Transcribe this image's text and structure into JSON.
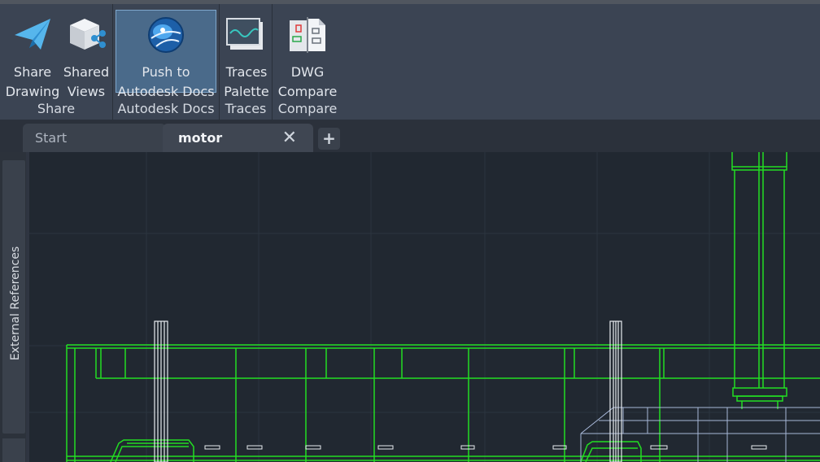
{
  "ribbon": {
    "panels": [
      {
        "title": "Share",
        "buttons": [
          {
            "line1": "Share",
            "line2": "Drawing",
            "icon": "paper-plane-icon"
          },
          {
            "line1": "Shared",
            "line2": "Views",
            "icon": "shared-views-cube-icon"
          }
        ]
      },
      {
        "title": "Autodesk Docs",
        "buttons": [
          {
            "line1": "Push to",
            "line2": "Autodesk Docs",
            "icon": "globe-icon"
          }
        ]
      },
      {
        "title": "Traces",
        "buttons": [
          {
            "line1": "Traces",
            "line2": "Palette",
            "icon": "traces-palette-icon"
          }
        ]
      },
      {
        "title": "Compare",
        "buttons": [
          {
            "line1": "DWG",
            "line2": "Compare",
            "icon": "dwg-compare-icon"
          }
        ]
      }
    ]
  },
  "tabs": {
    "items": [
      {
        "label": "Start"
      },
      {
        "label": "motor",
        "active": true,
        "close_glyph": "✕"
      }
    ],
    "add_glyph": "+"
  },
  "side_palette": {
    "label": "External References"
  },
  "colors": {
    "ribbon_bg": "#3b4453",
    "accent_selected": "#4a6a8a",
    "drawing_bg": "#212831",
    "geometry_green": "#22dd22",
    "geometry_white": "#e8ecf0",
    "geometry_blue": "#a8b8d8"
  }
}
